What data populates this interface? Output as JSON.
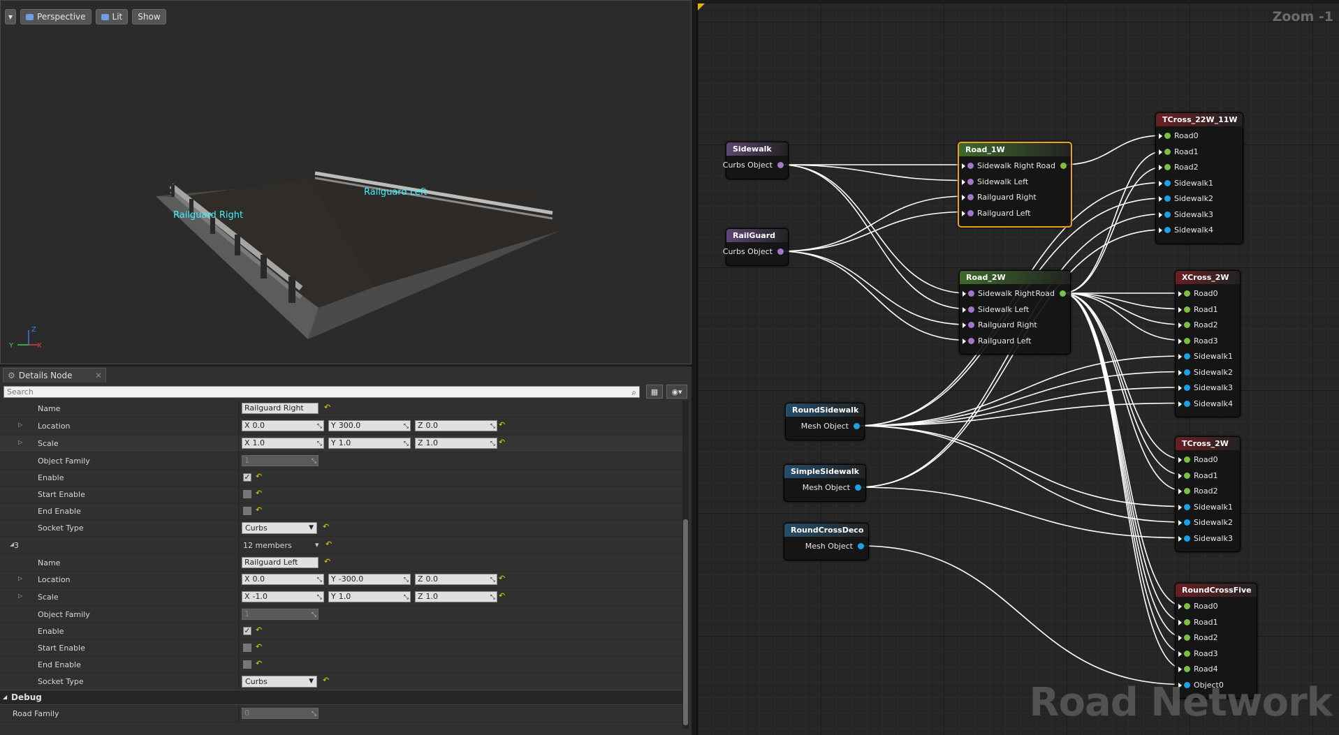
{
  "viewport": {
    "toolbar": {
      "perspective": "Perspective",
      "lit": "Lit",
      "show": "Show"
    },
    "labels": {
      "railguard_right": "Railguard Right",
      "railguard_left": "Railguard Left"
    },
    "axis": {
      "x": "X",
      "y": "Y",
      "z": "Z"
    }
  },
  "details": {
    "tab_title": "Details Node",
    "search_placeholder": "Search",
    "rows": [
      {
        "label": "Name",
        "value": "Railguard Right"
      },
      {
        "label": "Location",
        "x": "0.0",
        "y": "300.0",
        "z": "0.0"
      },
      {
        "label": "Scale",
        "x": "1.0",
        "y": "1.0",
        "z": "1.0"
      },
      {
        "label": "Object Family",
        "value": "1"
      },
      {
        "label": "Enable",
        "checked": true
      },
      {
        "label": "Start Enable",
        "checked": false
      },
      {
        "label": "End Enable",
        "checked": false
      },
      {
        "label": "Socket Type",
        "value": "Curbs"
      },
      {
        "label": "3",
        "value": "12 members"
      },
      {
        "label": "Name",
        "value": "Railguard Left"
      },
      {
        "label": "Location",
        "x": "0.0",
        "y": "-300.0",
        "z": "0.0"
      },
      {
        "label": "Scale",
        "x": "-1.0",
        "y": "1.0",
        "z": "1.0"
      },
      {
        "label": "Object Family",
        "value": "1"
      },
      {
        "label": "Enable",
        "checked": true
      },
      {
        "label": "Start Enable",
        "checked": false
      },
      {
        "label": "End Enable",
        "checked": false
      },
      {
        "label": "Socket Type",
        "value": "Curbs"
      }
    ],
    "axis_prefix": {
      "x": "X",
      "y": "Y",
      "z": "Z"
    },
    "debug": {
      "title": "Debug",
      "road_family_label": "Road Family",
      "road_family_value": "0"
    }
  },
  "graph": {
    "zoom": "Zoom -1",
    "watermark": "Road Network",
    "colors": {
      "purple": "#a875c8",
      "green": "#7ac143",
      "blue": "#1da1e6",
      "wire": "#ffffff"
    },
    "nodes": [
      {
        "id": "sidewalk",
        "title": "Sidewalk",
        "head": "#5d4672",
        "outputs": [
          {
            "label": "Curbs Object",
            "color": "purple"
          }
        ],
        "inputs": []
      },
      {
        "id": "railguard",
        "title": "RailGuard",
        "head": "#5d4672",
        "outputs": [
          {
            "label": "Curbs Object",
            "color": "purple"
          }
        ],
        "inputs": []
      },
      {
        "id": "road1w",
        "title": "Road_1W",
        "head": "#3e6a2a",
        "selected": true,
        "outputs": [
          {
            "label": "Road",
            "color": "green"
          }
        ],
        "inputs": [
          {
            "label": "Sidewalk Right",
            "color": "purple"
          },
          {
            "label": "Sidewalk Left",
            "color": "purple"
          },
          {
            "label": "Railguard Right",
            "color": "purple"
          },
          {
            "label": "Railguard Left",
            "color": "purple"
          }
        ]
      },
      {
        "id": "road2w",
        "title": "Road_2W",
        "head": "#3e6a2a",
        "outputs": [
          {
            "label": "Road",
            "color": "green"
          }
        ],
        "inputs": [
          {
            "label": "Sidewalk Right",
            "color": "purple"
          },
          {
            "label": "Sidewalk Left",
            "color": "purple"
          },
          {
            "label": "Railguard Right",
            "color": "purple"
          },
          {
            "label": "Railguard Left",
            "color": "purple"
          }
        ]
      },
      {
        "id": "roundsidewalk",
        "title": "RoundSidewalk",
        "head": "#244e6a",
        "outputs": [
          {
            "label": "Mesh Object",
            "color": "blue"
          }
        ],
        "inputs": []
      },
      {
        "id": "simplesidewalk",
        "title": "SimpleSidewalk",
        "head": "#244e6a",
        "outputs": [
          {
            "label": "Mesh Object",
            "color": "blue"
          }
        ],
        "inputs": []
      },
      {
        "id": "roundcrossdeco",
        "title": "RoundCrossDeco",
        "head": "#244e6a",
        "outputs": [
          {
            "label": "Mesh Object",
            "color": "blue"
          }
        ],
        "inputs": []
      },
      {
        "id": "tcross22",
        "title": "TCross_22W_11W",
        "head": "#6a1f22",
        "outputs": [],
        "inputs": [
          {
            "label": "Road0",
            "color": "green"
          },
          {
            "label": "Road1",
            "color": "green"
          },
          {
            "label": "Road2",
            "color": "green"
          },
          {
            "label": "Sidewalk1",
            "color": "blue"
          },
          {
            "label": "Sidewalk2",
            "color": "blue"
          },
          {
            "label": "Sidewalk3",
            "color": "blue"
          },
          {
            "label": "Sidewalk4",
            "color": "blue"
          }
        ]
      },
      {
        "id": "xcross",
        "title": "XCross_2W",
        "head": "#6a1f22",
        "outputs": [],
        "inputs": [
          {
            "label": "Road0",
            "color": "green"
          },
          {
            "label": "Road1",
            "color": "green"
          },
          {
            "label": "Road2",
            "color": "green"
          },
          {
            "label": "Road3",
            "color": "green"
          },
          {
            "label": "Sidewalk1",
            "color": "blue"
          },
          {
            "label": "Sidewalk2",
            "color": "blue"
          },
          {
            "label": "Sidewalk3",
            "color": "blue"
          },
          {
            "label": "Sidewalk4",
            "color": "blue"
          }
        ]
      },
      {
        "id": "tcross2w",
        "title": "TCross_2W",
        "head": "#6a1f22",
        "outputs": [],
        "inputs": [
          {
            "label": "Road0",
            "color": "green"
          },
          {
            "label": "Road1",
            "color": "green"
          },
          {
            "label": "Road2",
            "color": "green"
          },
          {
            "label": "Sidewalk1",
            "color": "blue"
          },
          {
            "label": "Sidewalk2",
            "color": "blue"
          },
          {
            "label": "Sidewalk3",
            "color": "blue"
          }
        ]
      },
      {
        "id": "roundcrossfive",
        "title": "RoundCrossFive",
        "head": "#6a1f22",
        "outputs": [],
        "inputs": [
          {
            "label": "Road0",
            "color": "green"
          },
          {
            "label": "Road1",
            "color": "green"
          },
          {
            "label": "Road2",
            "color": "green"
          },
          {
            "label": "Road3",
            "color": "green"
          },
          {
            "label": "Road4",
            "color": "green"
          },
          {
            "label": "Object0",
            "color": "blue"
          }
        ]
      }
    ],
    "links": [
      [
        "sidewalk",
        0,
        "road1w",
        0
      ],
      [
        "sidewalk",
        0,
        "road1w",
        1
      ],
      [
        "sidewalk",
        0,
        "road2w",
        0
      ],
      [
        "sidewalk",
        0,
        "road2w",
        1
      ],
      [
        "railguard",
        0,
        "road1w",
        2
      ],
      [
        "railguard",
        0,
        "road1w",
        3
      ],
      [
        "railguard",
        0,
        "road2w",
        2
      ],
      [
        "railguard",
        0,
        "road2w",
        3
      ],
      [
        "road1w",
        0,
        "tcross22",
        0
      ],
      [
        "road2w",
        0,
        "tcross22",
        1
      ],
      [
        "road2w",
        0,
        "tcross22",
        2
      ],
      [
        "road2w",
        0,
        "xcross",
        0
      ],
      [
        "road2w",
        0,
        "xcross",
        1
      ],
      [
        "road2w",
        0,
        "xcross",
        2
      ],
      [
        "road2w",
        0,
        "xcross",
        3
      ],
      [
        "road2w",
        0,
        "tcross2w",
        0
      ],
      [
        "road2w",
        0,
        "tcross2w",
        1
      ],
      [
        "road2w",
        0,
        "tcross2w",
        2
      ],
      [
        "road2w",
        0,
        "roundcrossfive",
        0
      ],
      [
        "road2w",
        0,
        "roundcrossfive",
        1
      ],
      [
        "road2w",
        0,
        "roundcrossfive",
        2
      ],
      [
        "road2w",
        0,
        "roundcrossfive",
        3
      ],
      [
        "road2w",
        0,
        "roundcrossfive",
        4
      ],
      [
        "roundsidewalk",
        0,
        "tcross22",
        3
      ],
      [
        "roundsidewalk",
        0,
        "tcross22",
        4
      ],
      [
        "roundsidewalk",
        0,
        "xcross",
        4
      ],
      [
        "roundsidewalk",
        0,
        "xcross",
        5
      ],
      [
        "roundsidewalk",
        0,
        "xcross",
        6
      ],
      [
        "roundsidewalk",
        0,
        "xcross",
        7
      ],
      [
        "roundsidewalk",
        0,
        "tcross2w",
        3
      ],
      [
        "roundsidewalk",
        0,
        "tcross2w",
        4
      ],
      [
        "simplesidewalk",
        0,
        "tcross22",
        5
      ],
      [
        "simplesidewalk",
        0,
        "tcross22",
        6
      ],
      [
        "simplesidewalk",
        0,
        "tcross2w",
        5
      ],
      [
        "roundcrossdeco",
        0,
        "roundcrossfive",
        5
      ]
    ]
  }
}
